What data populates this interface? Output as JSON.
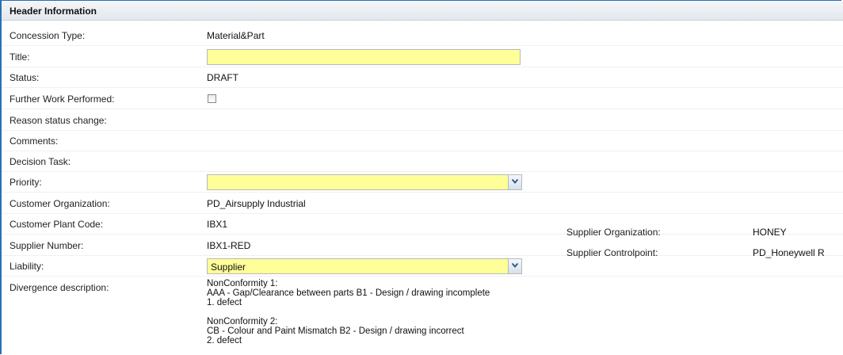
{
  "header": {
    "title": "Header Information"
  },
  "fields": {
    "concession_type": {
      "label": "Concession Type:",
      "value": "Material&Part"
    },
    "title": {
      "label": "Title:",
      "value": ""
    },
    "status": {
      "label": "Status:",
      "value": "DRAFT"
    },
    "further_work": {
      "label": "Further Work Performed:",
      "checked": false
    },
    "reason_status_change": {
      "label": "Reason status change:"
    },
    "comments": {
      "label": "Comments:"
    },
    "decision_task": {
      "label": "Decision Task:"
    },
    "priority": {
      "label": "Priority:",
      "value": ""
    },
    "customer_org": {
      "label": "Customer Organization:",
      "value": "PD_Airsupply Industrial"
    },
    "customer_plant": {
      "label": "Customer Plant Code:",
      "value": "IBX1"
    },
    "supplier_number": {
      "label": "Supplier Number:",
      "value": "IBX1-RED"
    },
    "liability": {
      "label": "Liability:",
      "value": "Supplier"
    },
    "divergence": {
      "label": "Divergence description:",
      "entries": [
        {
          "heading": "NonConformity 1:",
          "detail": "AAA - Gap/Clearance between parts B1 - Design / drawing incomplete",
          "defect": "1. defect"
        },
        {
          "heading": "NonConformity 2:",
          "detail": "CB - Colour and Paint Mismatch B2 - Design / drawing incorrect",
          "defect": "2. defect"
        }
      ]
    }
  },
  "supplier": {
    "org_label": "Supplier Organization:",
    "org_value": "HONEY",
    "cp_label": "Supplier Controlpoint:",
    "cp_value": "PD_Honeywell R"
  },
  "colors": {
    "required_field": "#ffff99",
    "frame_border": "#2a6fb2"
  }
}
